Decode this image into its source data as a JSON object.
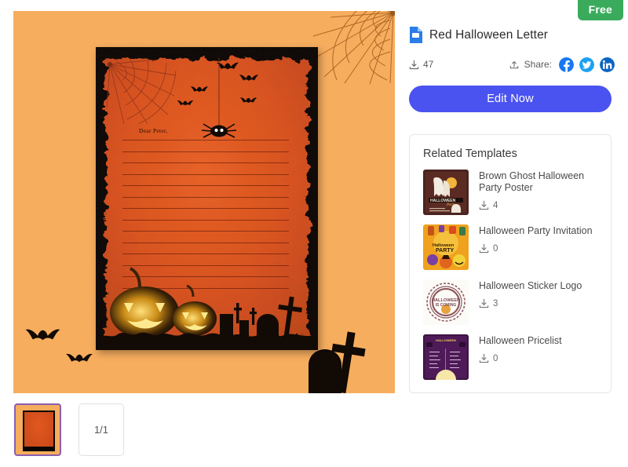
{
  "badge": {
    "label": "Free",
    "color": "#3aab5c"
  },
  "header": {
    "title": "Red Halloween Letter",
    "doc_icon": "google-slides-document-icon",
    "download_icon": "download-icon",
    "download_count": "47",
    "share_icon": "share-upload-icon",
    "share_label": "Share:",
    "social": [
      {
        "name": "facebook-share-icon",
        "glyph": "f",
        "color": "#1877f2"
      },
      {
        "name": "twitter-share-icon",
        "glyph": "t",
        "color": "#1da1f2"
      },
      {
        "name": "linkedin-share-icon",
        "glyph": "in",
        "color": "#0a66c2"
      }
    ],
    "edit_button": "Edit Now",
    "edit_button_color": "#4a53ef"
  },
  "related": {
    "title": "Related Templates",
    "items": [
      {
        "name": "Brown Ghost Halloween Party Poster",
        "downloads": "4",
        "thumb": "brown-ghost-halloween-party-poster-thumbnail"
      },
      {
        "name": "Halloween Party Invitation",
        "downloads": "0",
        "thumb": "halloween-party-invitation-thumbnail"
      },
      {
        "name": "Halloween Sticker Logo",
        "downloads": "3",
        "thumb": "halloween-sticker-logo-thumbnail"
      },
      {
        "name": "Halloween Pricelist",
        "downloads": "0",
        "thumb": "halloween-pricelist-thumbnail"
      }
    ]
  },
  "preview": {
    "background_color": "#f6ad5e",
    "letter_salutation": "Dear Peter,",
    "decorations": [
      "spider-web-icon",
      "hanging-spider-icon",
      "bat-icon",
      "pumpkin-icon",
      "tombstone-cross-icon"
    ],
    "line_count": 14
  },
  "thumbnails": {
    "page_indicator": "1/1",
    "selected_index": 0
  }
}
